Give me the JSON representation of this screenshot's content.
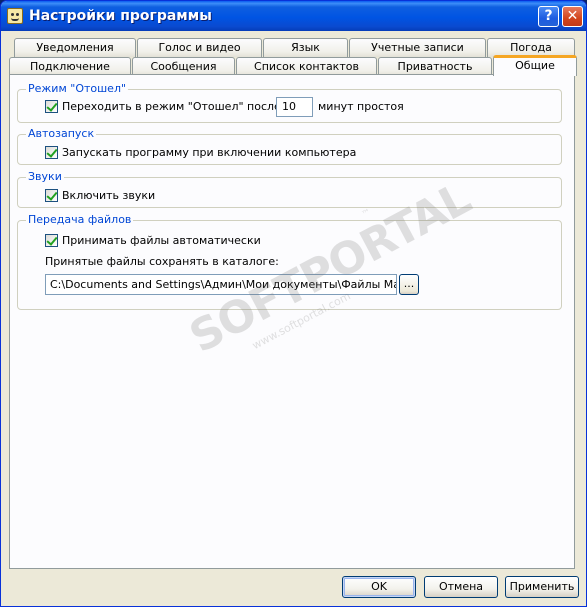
{
  "window": {
    "title": "Настройки программы",
    "help_label": "?",
    "close_label": "✕"
  },
  "tabs_row1": [
    {
      "label": "Уведомления"
    },
    {
      "label": "Голос и видео"
    },
    {
      "label": "Язык"
    },
    {
      "label": "Учетные записи"
    },
    {
      "label": "Погода"
    }
  ],
  "tabs_row2": [
    {
      "label": "Подключение"
    },
    {
      "label": "Сообщения"
    },
    {
      "label": "Список контактов"
    },
    {
      "label": "Приватность"
    },
    {
      "label": "Общие"
    }
  ],
  "groups": {
    "away": {
      "title": "Режим \"Отошел\"",
      "checkbox_label": "Переходить в режим \"Отошел\" после",
      "checked": true,
      "minutes_value": "10",
      "minutes_suffix": "минут простоя"
    },
    "autostart": {
      "title": "Автозапуск",
      "checkbox_label": "Запускать программу при включении компьютера",
      "checked": true
    },
    "sounds": {
      "title": "Звуки",
      "checkbox_label": "Включить звуки",
      "checked": true
    },
    "file_transfer": {
      "title": "Передача файлов",
      "checkbox_label": "Принимать файлы автоматически",
      "checked": true,
      "folder_label": "Принятые файлы сохранять в каталоге:",
      "folder_path": "C:\\Documents and Settings\\Админ\\Мои документы\\Файлы Mail.Ru Аг",
      "browse_label": "..."
    }
  },
  "buttons": {
    "ok": "OK",
    "cancel": "Отмена",
    "apply": "Применить"
  },
  "watermark": {
    "text": "SOFTPORTAL",
    "url": "www.softportal.com",
    "tm": "™"
  },
  "colors": {
    "title_bar": "#0054e3",
    "group_title": "#0046d5",
    "active_tab_accent": "#f5a623",
    "face": "#ece9d8"
  }
}
